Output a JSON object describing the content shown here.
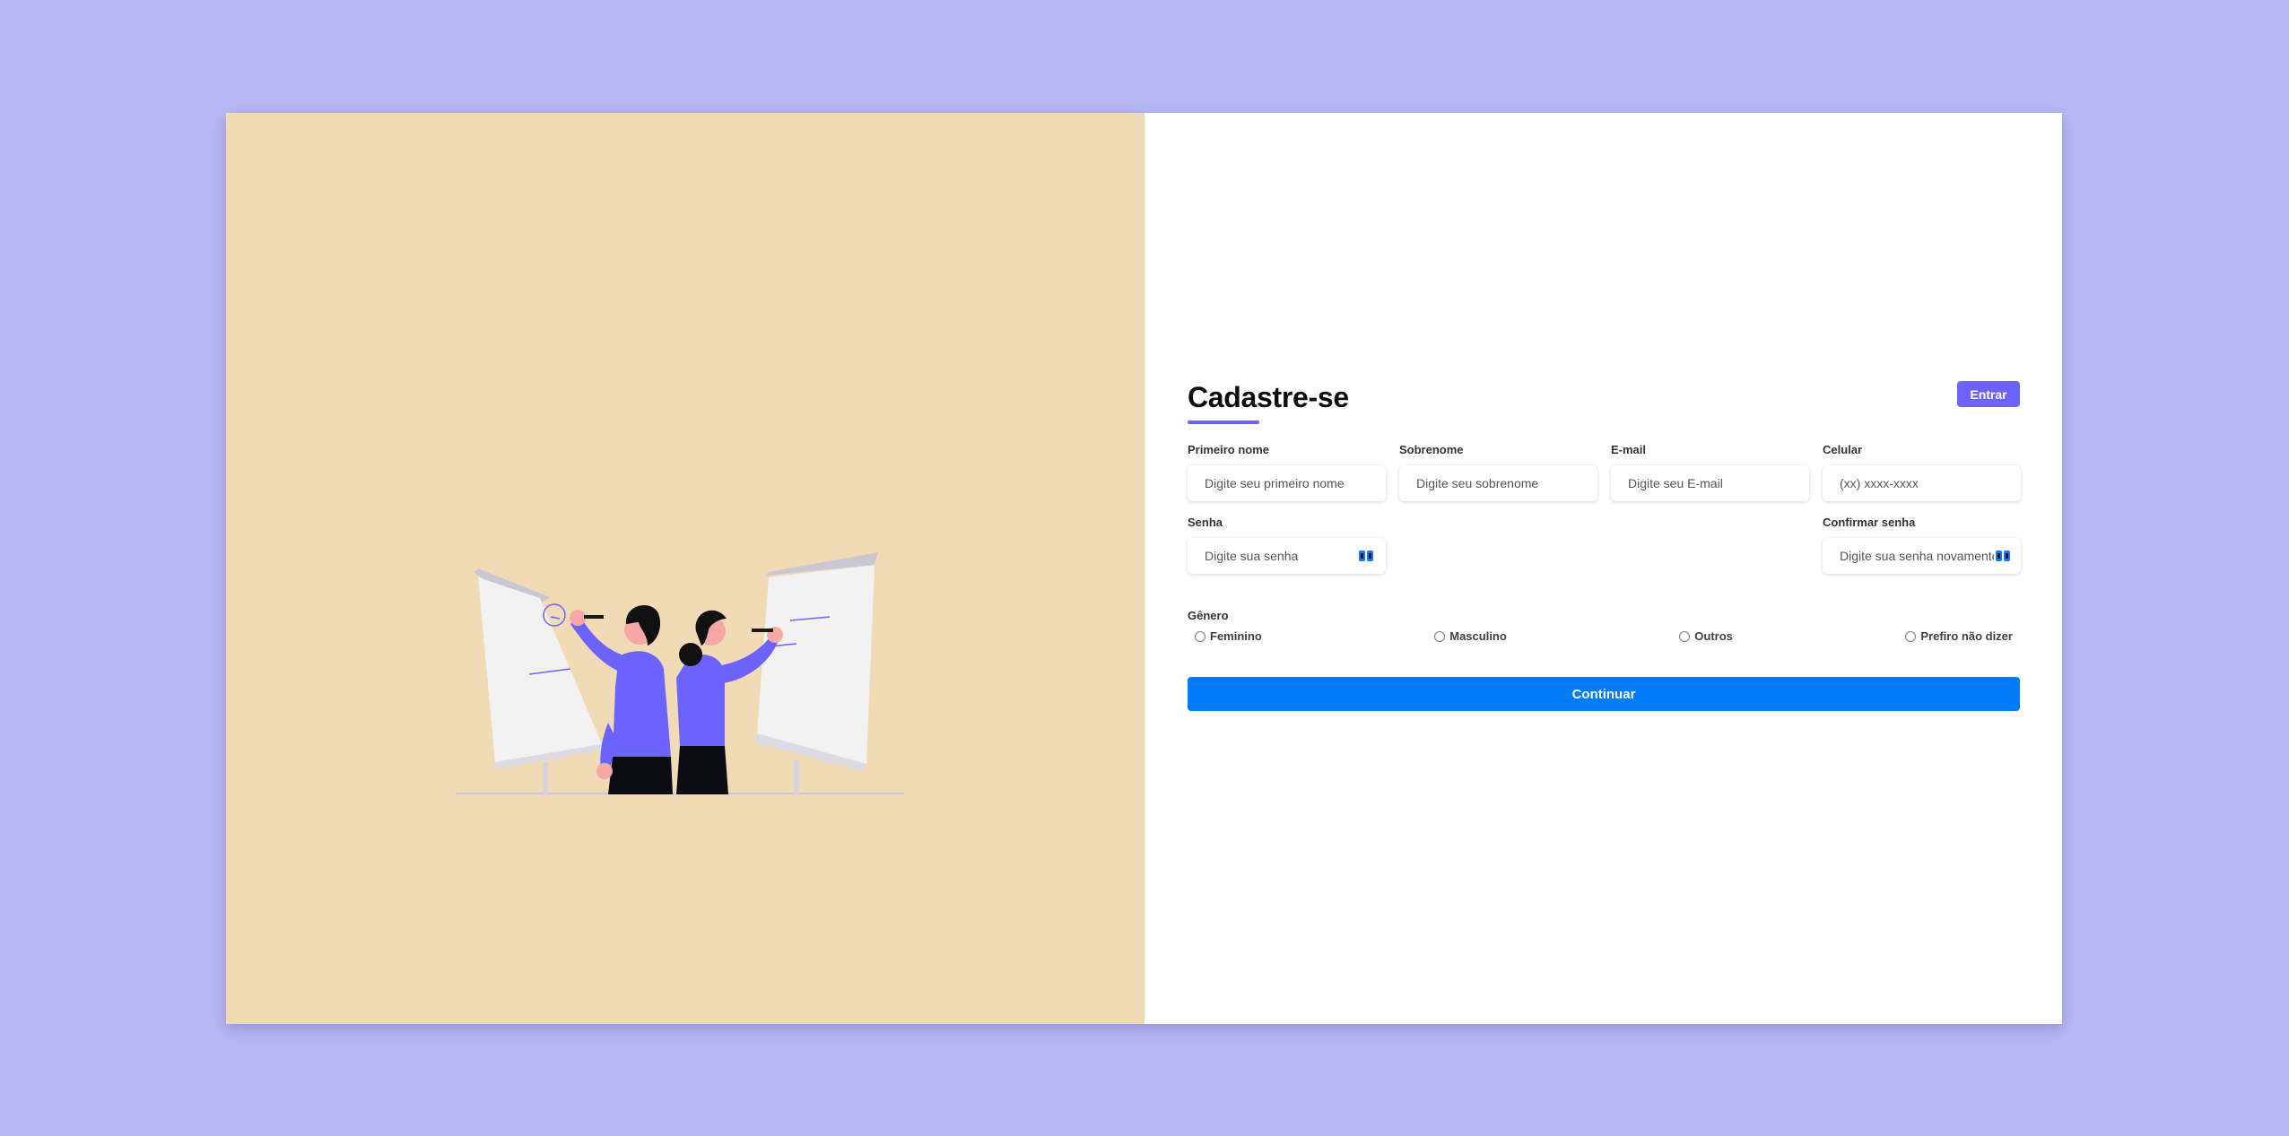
{
  "colors": {
    "background": "#b8b7f6",
    "left_panel": "#f1dab6",
    "accent": "#6c63ff",
    "primary_button": "#007cf8"
  },
  "illustration": {
    "icon": "two-people-presenting-on-flipcharts"
  },
  "form": {
    "title": "Cadastre-se",
    "login_button": "Entrar",
    "fields": {
      "first_name": {
        "label": "Primeiro nome",
        "placeholder": "Digite seu primeiro nome",
        "value": ""
      },
      "last_name": {
        "label": "Sobrenome",
        "placeholder": "Digite seu sobrenome",
        "value": ""
      },
      "email": {
        "label": "E-mail",
        "placeholder": "Digite seu E-mail",
        "value": ""
      },
      "phone": {
        "label": "Celular",
        "placeholder": "(xx) xxxx-xxxx",
        "value": ""
      },
      "password": {
        "label": "Senha",
        "placeholder": "Digite sua senha",
        "value": "",
        "icon": "password-visibility-icon"
      },
      "confirm_password": {
        "label": "Confirmar senha",
        "placeholder": "Digite sua senha novamente",
        "value": "",
        "icon": "password-visibility-icon"
      }
    },
    "gender": {
      "label": "Gênero",
      "options": [
        "Feminino",
        "Masculino",
        "Outros",
        "Prefiro não dizer"
      ]
    },
    "submit_button": "Continuar"
  }
}
